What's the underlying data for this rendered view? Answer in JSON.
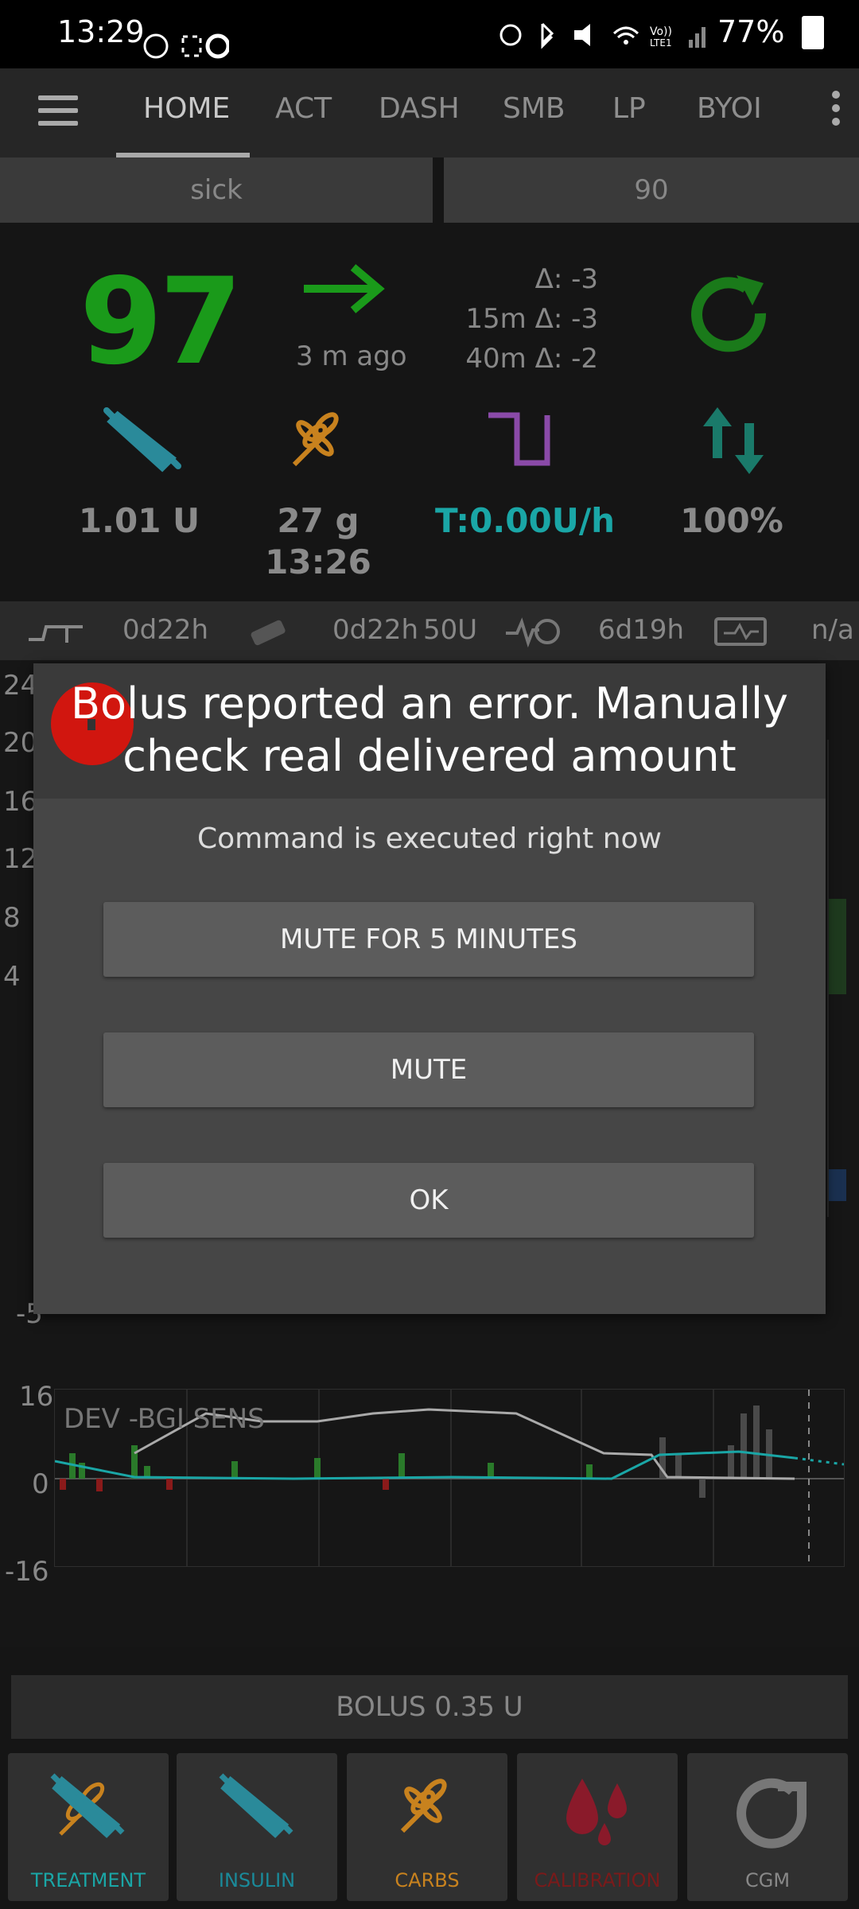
{
  "status_bar": {
    "time": "13:29",
    "battery": "77%"
  },
  "nav": {
    "tabs": [
      "HOME",
      "ACT",
      "DASH",
      "SMB",
      "LP",
      "BYOI"
    ]
  },
  "profile": {
    "left": "sick",
    "right": "90"
  },
  "glucose": {
    "value": "97",
    "ago": "3 m ago",
    "delta": "Δ: -3",
    "delta_15m": "15m Δ: -3",
    "delta_40m": "40m Δ: -2",
    "color": "#1a9a1a"
  },
  "stats": {
    "iob": "1.01 U",
    "carbs": "27 g",
    "carbs_time": "13:26",
    "temp_basal": "T:0.00U/h",
    "percent": "100%"
  },
  "info_bar": {
    "cannula_age": "0d22h",
    "reservoir_age": "0d22h",
    "reservoir_level": "50U",
    "sensor_age": "6d19h",
    "pump_battery": "n/a"
  },
  "graph": {
    "y_labels": [
      "24",
      "20",
      "16",
      "12",
      "8",
      "4"
    ],
    "y_label_lower": "-5"
  },
  "dialog": {
    "title": "Bolus reported an error. Manually check real delivered amount",
    "subtitle": "Command is executed right now",
    "buttons": {
      "mute5": "MUTE FOR 5 MINUTES",
      "mute": "MUTE",
      "ok": "OK"
    }
  },
  "dev_graph": {
    "label": "DEV -BGI SENS",
    "y_top": "16",
    "y_mid": "0",
    "y_bottom": "-16"
  },
  "bolus_button": "BOLUS 0.35 U",
  "actions": {
    "treatment": "TREATMENT",
    "insulin": "INSULIN",
    "carbs": "CARBS",
    "calibration": "CALIBRATION",
    "cgm": "CGM"
  },
  "colors": {
    "accent_teal": "#1aa6a6",
    "carbs_orange": "#c8821e",
    "error_red": "#d1160f",
    "loop_green": "#1a9a1a",
    "basal_purple": "#8a4aa8"
  }
}
